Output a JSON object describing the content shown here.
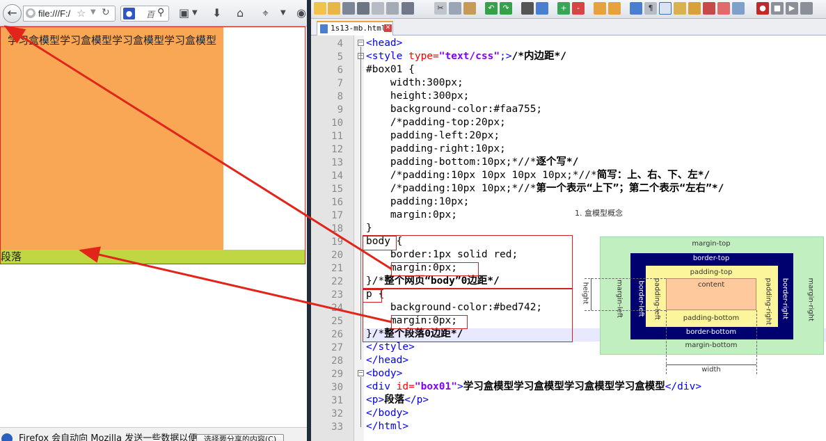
{
  "browser": {
    "url": "file:///F:/",
    "search_placeholder": "百",
    "search_engine": "paw-icon",
    "box_text": "学习盒模型学习盒模型学习盒模型学习盒模型",
    "paragraph_text": "段落",
    "notification_text": "Firefox 会自动向 Mozilla 发送一些数据以便",
    "notification_button": "选择要分享的内容(C)"
  },
  "editor": {
    "tab_label": "1s13-mb.html",
    "line_numbers": [
      "4",
      "5",
      "6",
      "7",
      "8",
      "9",
      "10",
      "11",
      "12",
      "13",
      "14",
      "15",
      "16",
      "17",
      "18",
      "19",
      "20",
      "21",
      "22",
      "23",
      "24",
      "25",
      "26",
      "27",
      "28",
      "29",
      "30",
      "31",
      "32",
      "33"
    ],
    "lines": {
      "l4": "<head>",
      "l5_tag_open": "<style ",
      "l5_attr": "type=",
      "l5_val": "\"text/css\"",
      "l5_tag_close": ";>",
      "l5_comment": "/*内边距*/",
      "l6": "#box01 {",
      "l7": "    width:300px;",
      "l8": "    height:300px;",
      "l9": "    background-color:#faa755;",
      "l10": "    /*padding-top:20px;",
      "l11": "    padding-left:20px;",
      "l12": "    padding-right:10px;",
      "l13_a": "    padding-bottom:10px;*//*",
      "l13_b": "逐个写*/",
      "l14_a": "    /*padding:10px 10px 10px 10px;*//*",
      "l14_b": "简写：上、右、下、左*/",
      "l15_a": "    /*padding:10px 10px;*//*",
      "l15_b": "第一个表示“上下”；第二个表示“左右”*/",
      "l16": "    padding:10px;",
      "l17": "    margin:0px;",
      "l18": "}",
      "l19": "body {",
      "l20": "    border:1px solid red;",
      "l21": "    margin:0px;",
      "l22_a": "}/*",
      "l22_b": "整个网页“body”0边距*/",
      "l23": "p {",
      "l24": "    background-color:#bed742;",
      "l25": "    margin:0px;",
      "l26_a": "}/*",
      "l26_b": "整个段落0边距*/",
      "l27": "</style>",
      "l28": "</head>",
      "l29": "<body>",
      "l30_open": "<div ",
      "l30_attr": "id=",
      "l30_val": "\"box01\"",
      "l30_gt": ">",
      "l30_text": "学习盒模型学习盒模型学习盒模型学习盒模型",
      "l30_close": "</div>",
      "l31_open": "<p>",
      "l31_text": "段落",
      "l31_close": "</p>",
      "l32": "</body>",
      "l33": "</html>"
    }
  },
  "diagram": {
    "caption": "1. 盒模型概念",
    "margin_top": "margin-top",
    "margin_bottom": "margin-bottom",
    "margin_left": "margin-left",
    "margin_right": "margin-right",
    "border_top": "border-top",
    "border_bottom": "border-bottom",
    "border_left": "border-left",
    "border_right": "border-right",
    "padding_top": "padding-top",
    "padding_bottom": "padding-bottom",
    "padding_left": "padding-left",
    "padding_right": "padding-right",
    "content": "content",
    "height": "height",
    "width": "width"
  },
  "colors": {
    "box_bg": "#faa755",
    "p_bg": "#bed742",
    "annotation_red": "#e1251b"
  }
}
